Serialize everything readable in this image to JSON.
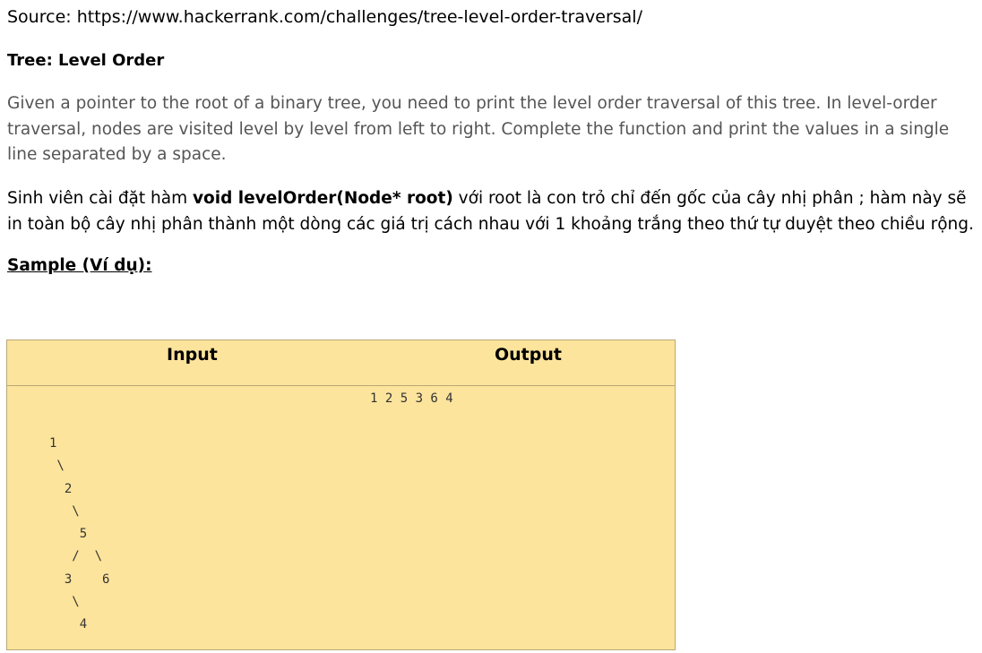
{
  "source": {
    "text": "Source: https://www.hackerrank.com/challenges/tree-level-order-traversal/"
  },
  "problem": {
    "title": "Tree: Level Order",
    "description_en": "Given a pointer to the root of a binary tree, you need to print the level order traversal of this tree. In level-order traversal, nodes are visited level by level from left to right. Complete the function  and print the values in a single line separated by a space.",
    "description_vi": {
      "prefix": "Sinh viên cài đặt hàm ",
      "function_signature": "void levelOrder(Node* root)",
      "suffix": " với root là con trỏ chỉ đến gốc của cây nhị phân ; hàm này sẽ in toàn bộ cây nhị phân thành một dòng các giá trị cách nhau với 1 khoảng trắng theo thứ tự duyệt theo chiều rộng."
    }
  },
  "sample": {
    "heading": "Sample (Ví dụ):",
    "table": {
      "header_input": "Input",
      "header_output": "Output",
      "output_value": "1 2 5 3 6 4",
      "input_tree_text": "1\n \\\n  2\n   \\\n    5\n   /  \\\n  3    6\n   \\\n    4"
    }
  }
}
